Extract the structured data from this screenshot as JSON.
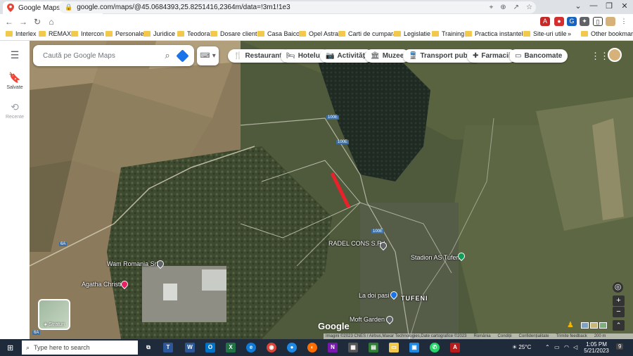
{
  "browser": {
    "tab_title": "Google Maps",
    "new_tab": "+",
    "url": "google.com/maps/@45.0684393,25.8251416,2364m/data=!3m1!1e3"
  },
  "bookmarks": [
    "Interlex",
    "REMAX",
    "Intercon",
    "Personale",
    "Juridice",
    "Teodora",
    "Dosare clienti",
    "Casa Baicoi",
    "Opel Astra",
    "Carti de cumparat",
    "Legislatie",
    "Training",
    "Practica instantelor",
    "Site-uri utile"
  ],
  "bookmarks_more": "»",
  "bookmarks_other": "Other bookmarks",
  "rail": {
    "saved": "Salvate",
    "recent": "Recente"
  },
  "search": {
    "placeholder": "Caută pe Google Maps"
  },
  "chips": [
    "Restaurante",
    "Hoteluri",
    "Activități",
    "Muzee",
    "Transport public",
    "Farmacii",
    "Bancomate"
  ],
  "map": {
    "labels": {
      "radel": "RADEL CONS S.R.L",
      "wam": "Wam Romania Srl",
      "agatha": "Agatha Christie",
      "stadion": "Stadion AS Tufeni",
      "la_doi_pasi": "La doi pasi",
      "tufeni": "TUFENI",
      "moft": "Moft Garden"
    },
    "road_shields": {
      "r1": "100E",
      "r2": "100E",
      "r3": "100E",
      "r4": "6A",
      "r5": "6A"
    },
    "layers_label": "Straturi",
    "google": "Google",
    "attribution": [
      "Imagini ©2023 CNES / Airbus,Maxar Technologies,Date cartografice ©2023",
      "România",
      "Condiții",
      "Confidențialitate",
      "Trimite feedback",
      "200 m"
    ]
  },
  "taskbar": {
    "search_placeholder": "Type here to search",
    "weather": "25°C",
    "time": "1:05 PM",
    "date": "5/21/2023",
    "notifications": "9"
  },
  "colors": {
    "highlight": "#e8212b",
    "chrome_blue": "#1a73e8",
    "taskbar": "#1f2a3a"
  }
}
